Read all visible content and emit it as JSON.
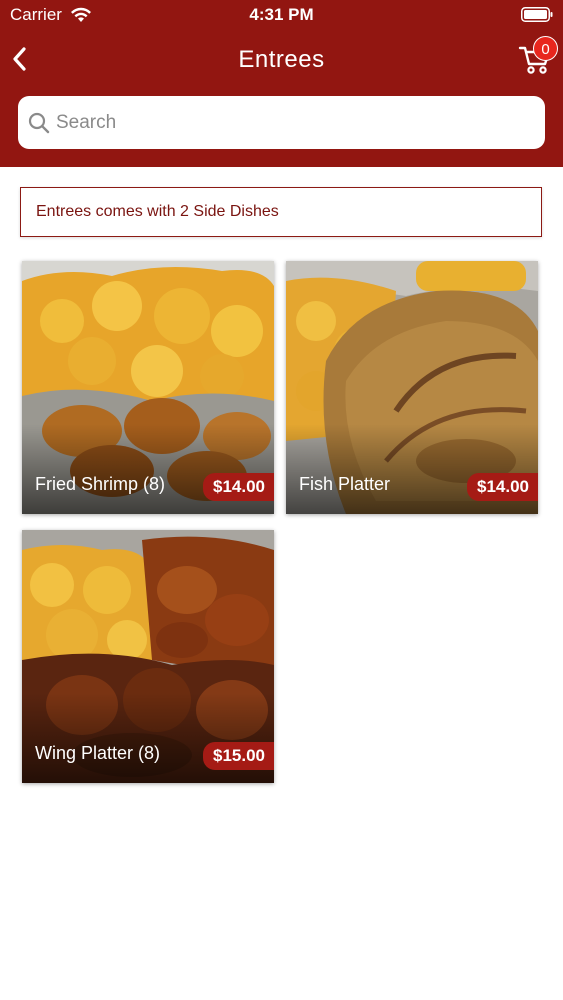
{
  "status_bar": {
    "carrier": "Carrier",
    "time": "4:31 PM"
  },
  "nav": {
    "title": "Entrees",
    "cart_count": "0"
  },
  "search": {
    "placeholder": "Search"
  },
  "notice": "Entrees comes with 2 Side Dishes",
  "items": [
    {
      "name": "Fried Shrimp (8)",
      "price": "$14.00"
    },
    {
      "name": "Fish Platter",
      "price": "$14.00"
    },
    {
      "name": "Wing Platter (8)",
      "price": "$15.00"
    }
  ],
  "colors": {
    "header": "#921611",
    "badge": "#e8261d",
    "price_tag": "#a51b15"
  }
}
